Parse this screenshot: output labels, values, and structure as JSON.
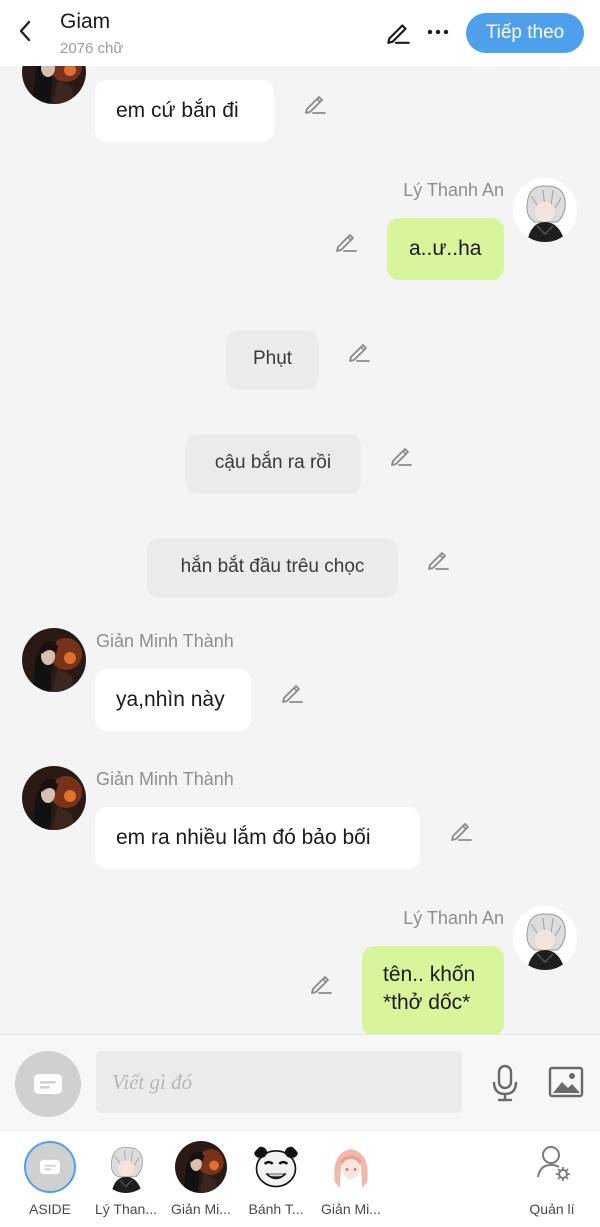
{
  "header": {
    "title": "Giam",
    "word_count": "2076 chữ",
    "next_label": "Tiếp theo"
  },
  "messages": [
    {
      "type": "left",
      "name": "",
      "text": "em cứ bắn đi"
    },
    {
      "type": "right",
      "name": "Lý Thanh An",
      "text": "a..ư..ha"
    },
    {
      "type": "narration",
      "text": "Phụt"
    },
    {
      "type": "narration",
      "text": "cậu bắn ra rồi"
    },
    {
      "type": "narration",
      "text": "hắn bắt đầu trêu chọc"
    },
    {
      "type": "left",
      "name": "Giản Minh Thành",
      "text": "ya,nhìn này"
    },
    {
      "type": "left",
      "name": "Giản Minh Thành",
      "text": "em ra nhiều lắm đó bảo bối"
    },
    {
      "type": "right",
      "name": "Lý Thanh An",
      "text_line1": "tên.. khốn",
      "text_line2": "*thở dốc*"
    }
  ],
  "input": {
    "placeholder": "Viết gì đó"
  },
  "characters": [
    {
      "label": "ASIDE"
    },
    {
      "label": "Lý Than..."
    },
    {
      "label": "Giản Mi..."
    },
    {
      "label": "Bánh T..."
    },
    {
      "label": "Giản Mi..."
    }
  ],
  "manage_label": "Quản lí",
  "colors": {
    "accent": "#4fa0ec",
    "own_bubble": "#d9f59c",
    "other_bubble": "#ffffff",
    "narration_bubble": "#ebebeb"
  }
}
